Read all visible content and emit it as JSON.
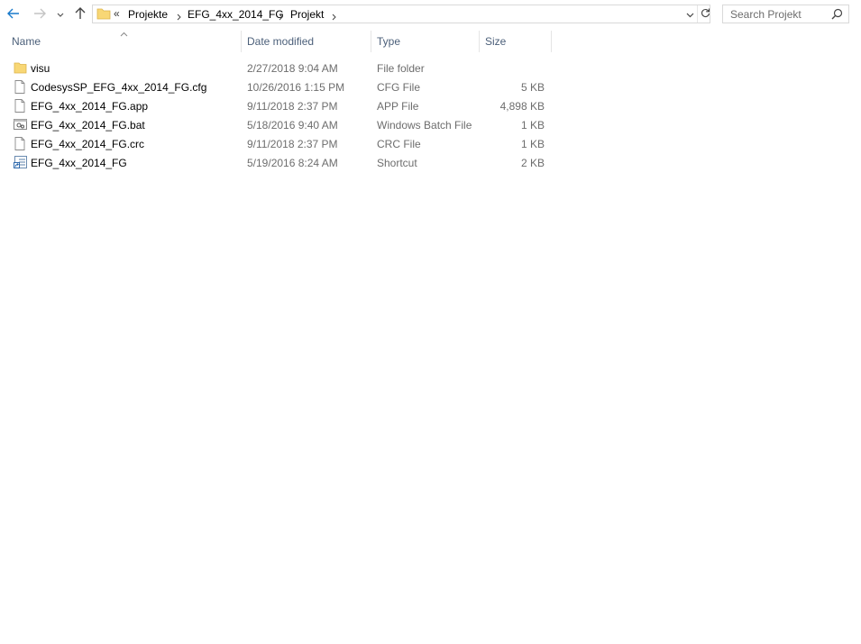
{
  "address": {
    "overflow_chevron": "«",
    "breadcrumbs": [
      "Projekte",
      "EFG_4xx_2014_FG",
      "Projekt"
    ]
  },
  "search": {
    "placeholder": "Search Projekt"
  },
  "columns": {
    "name": "Name",
    "date": "Date modified",
    "type": "Type",
    "size": "Size"
  },
  "files": [
    {
      "name": "visu",
      "date": "2/27/2018 9:04 AM",
      "type": "File folder",
      "size": "",
      "icon": "folder-icon"
    },
    {
      "name": "CodesysSP_EFG_4xx_2014_FG.cfg",
      "date": "10/26/2016 1:15 PM",
      "type": "CFG File",
      "size": "5 KB",
      "icon": "file-icon"
    },
    {
      "name": "EFG_4xx_2014_FG.app",
      "date": "9/11/2018 2:37 PM",
      "type": "APP File",
      "size": "4,898 KB",
      "icon": "file-icon"
    },
    {
      "name": "EFG_4xx_2014_FG.bat",
      "date": "5/18/2016 9:40 AM",
      "type": "Windows Batch File",
      "size": "1 KB",
      "icon": "batch-file-icon"
    },
    {
      "name": "EFG_4xx_2014_FG.crc",
      "date": "9/11/2018 2:37 PM",
      "type": "CRC File",
      "size": "1 KB",
      "icon": "file-icon"
    },
    {
      "name": "EFG_4xx_2014_FG",
      "date": "5/19/2016 8:24 AM",
      "type": "Shortcut",
      "size": "2 KB",
      "icon": "shortcut-icon"
    }
  ],
  "colors": {
    "accent": "#1979ca",
    "folder": "#f8d775",
    "header_text": "#4c607a",
    "meta_text": "#6d6d6d"
  }
}
